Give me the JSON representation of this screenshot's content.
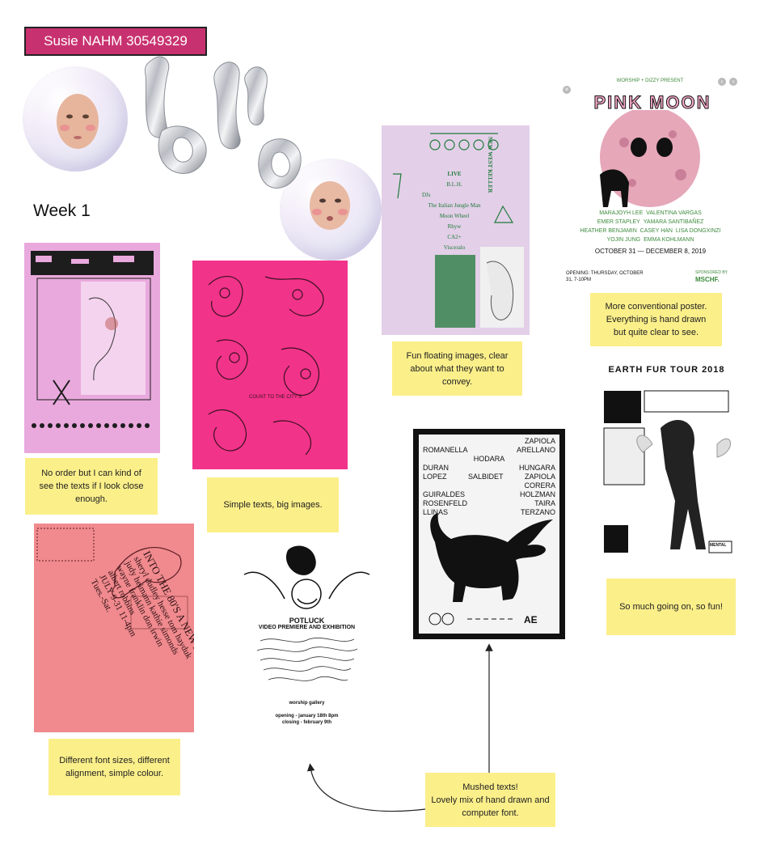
{
  "header": {
    "name_tag": "Susie NAHM 30549329",
    "week_label": "Week 1"
  },
  "notes": {
    "note_1": "No order but I can kind of see the texts if I look close enough.",
    "note_2": "Simple texts, big images.",
    "note_3": "Fun floating images, clear about what they want to convey.",
    "note_4": "More conventional poster.\nEverything is hand drawn\nbut quite clear to see.",
    "note_5": "So much going on, so fun!",
    "note_6": "Different font sizes, different alignment, simple colour.",
    "note_7": "Mushed texts!\nLovely mix of hand drawn and\ncomputer font."
  },
  "posters": {
    "pink_moon": {
      "presenter": "WORSHIP + DIZZY PRESENT",
      "title": "PINK MOON",
      "artists": [
        "MARAJOYH LEE",
        "VALENTINA VARGAS",
        "EMER STAPLEY",
        "YAMARA SANTIBAÑEZ",
        "HEATHER BENJAMIN",
        "CASEY HAN",
        "LISA DONGXINZI",
        "YOJIN JUNG",
        "EMMA KOHLMANN"
      ],
      "dates": "OCTOBER 31 — DECEMBER 8, 2019",
      "opening": "OPENING: THURSDAY, OCTOBER 31, 7-10PM",
      "sponsor_label": "SPONSORED BY",
      "sponsor": "MSCHF."
    },
    "earth_fur": {
      "title": "EARTH FUR TOUR 2018",
      "badge": "MENTAL"
    },
    "event_flyer": {
      "live": "LIVE",
      "lineup": [
        "B.L.H.",
        "Moon Wheel",
        "CA2+",
        "Visceralo"
      ],
      "djs": "DJs",
      "dj_lineup": [
        "The Italian Jungle Man",
        "Rhyw"
      ],
      "heading": "NEW WEST KELLER"
    },
    "potluck": {
      "title": "POTLUCK",
      "subtitle": "VIDEO PREMIERE AND EXHIBITION",
      "venue": "worship gallery",
      "opening": "opening - january 18th 8pm",
      "closing": "closing - february 9th"
    },
    "names_poster": {
      "names": [
        "ZAPIOLA",
        "ROMANELLA",
        "ARELLANO",
        "HODARA",
        "DURAN",
        "HUNGARA",
        "LOPEZ",
        "SALBIDET",
        "ZAPIOLA",
        "CORERA",
        "GUIRALDES",
        "HOLZMAN",
        "ROSENFELD",
        "TAIRA",
        "LLINAS",
        "TERZANO"
      ]
    },
    "eighties": {
      "text_lines": [
        "INTO THE 80'S A NEW AESTHETIC?",
        "sheryl dudley hesse tom hayduk",
        "judy heimann kathie simonds",
        "wayne franklin don irwin",
        "albert robbins",
        "JULY 9-31 11-4pm",
        "Tues.-Sat."
      ]
    }
  },
  "colors": {
    "name_tag_bg": "#c8316f",
    "note_bg": "#fbef8a",
    "pink_poster": "#e9a9dd",
    "magenta_poster": "#f2338a",
    "lilac_poster": "#e3cfe8",
    "salmon_poster": "#f08a8e"
  }
}
